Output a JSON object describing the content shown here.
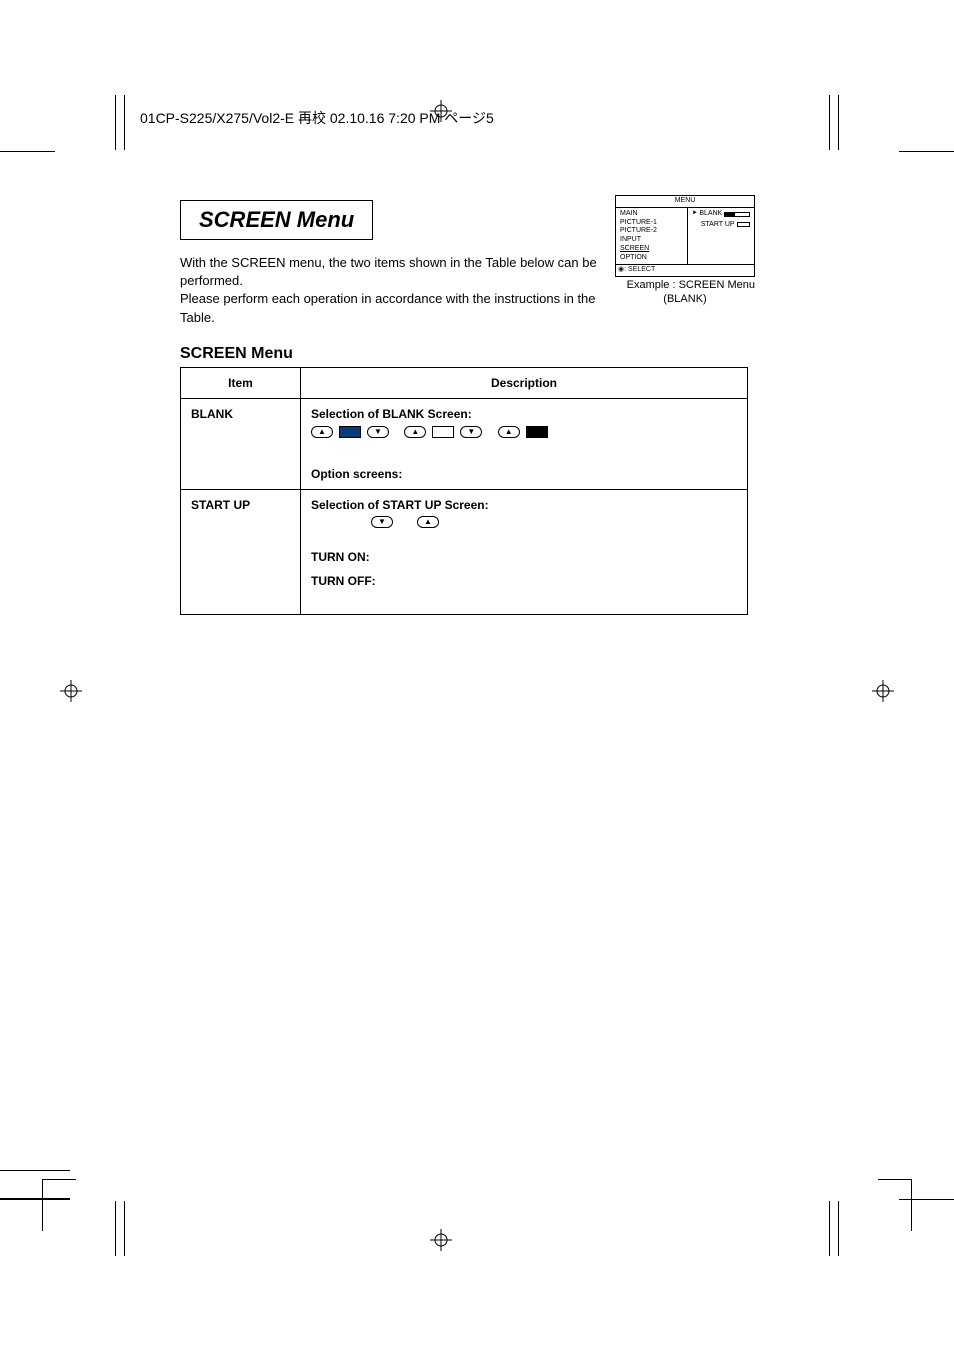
{
  "header": {
    "runhead": "01CP-S225/X275/Vol2-E  再校  02.10.16  7:20 PM  ページ5"
  },
  "title": "SCREEN Menu",
  "intro_line1": "With the SCREEN menu, the two items shown in the Table below can be performed.",
  "intro_line2": "Please perform each operation in accordance with the instructions in the Table.",
  "subheading": "SCREEN Menu",
  "table": {
    "headers": {
      "item": "Item",
      "description": "Description"
    },
    "rows": [
      {
        "item": "BLANK",
        "heading": "Selection of BLANK Screen:",
        "option_screens_label": "Option screens:"
      },
      {
        "item": "START UP",
        "heading": "Selection of START UP Screen:",
        "turn_on": "TURN ON:",
        "turn_off": "TURN OFF:"
      }
    ]
  },
  "osd": {
    "menu_title": "MENU",
    "left_items": [
      "MAIN",
      "PICTURE-1",
      "PICTURE-2",
      "INPUT",
      "SCREEN",
      "OPTION"
    ],
    "selected_left": "SCREEN",
    "right_items": [
      "BLANK",
      "START UP"
    ],
    "select_label": ": SELECT",
    "caption1": "Example : SCREEN Menu",
    "caption2": "(BLANK)"
  },
  "icons": {
    "up": "▲",
    "down": "▼",
    "cursor": "⯈"
  }
}
